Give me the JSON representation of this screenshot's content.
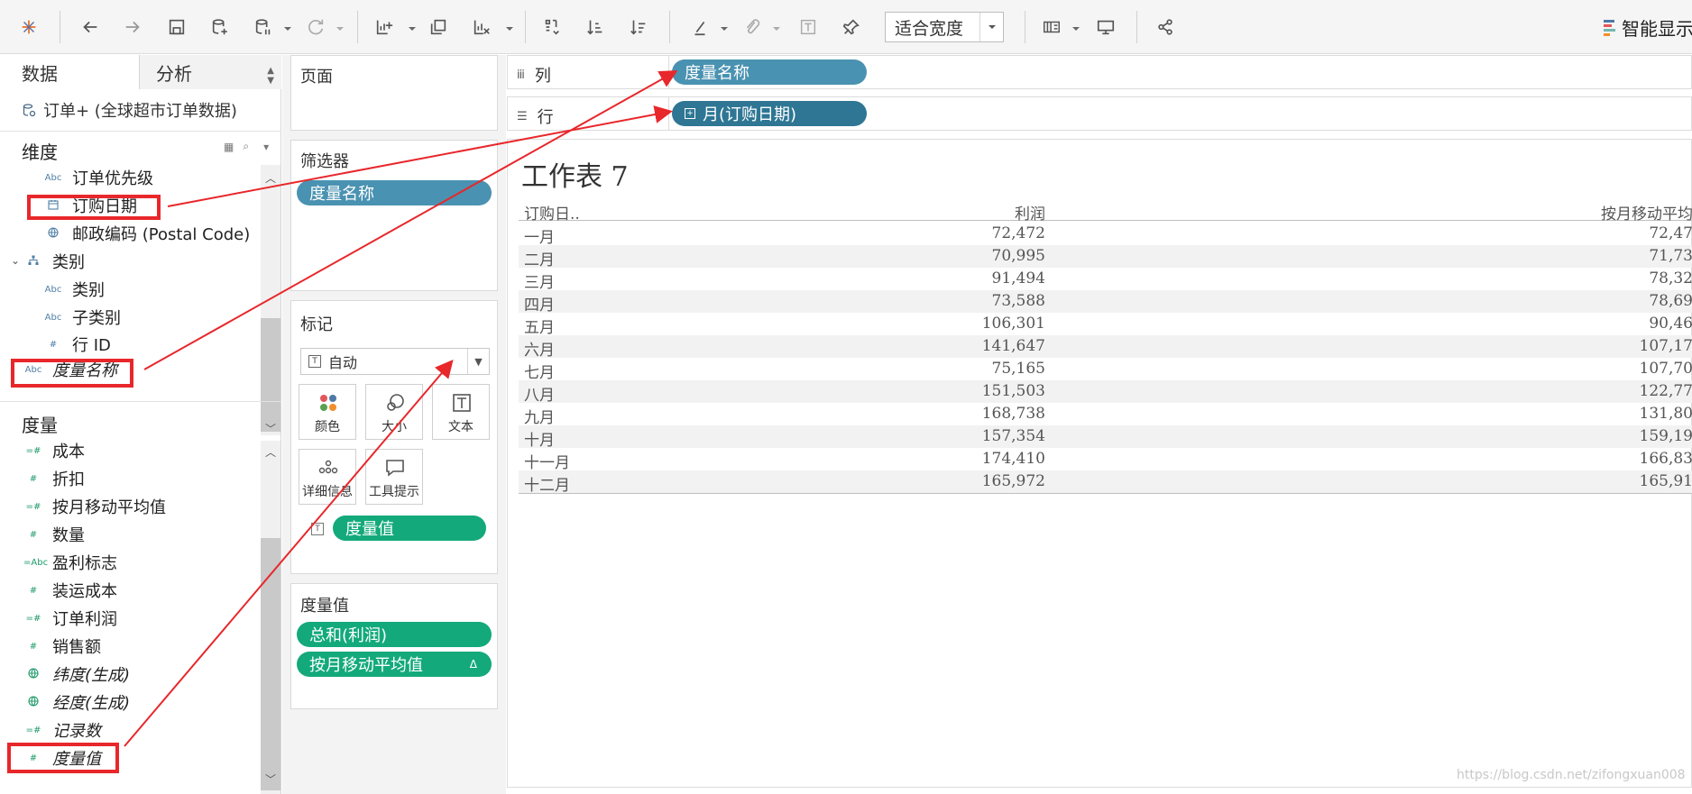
{
  "toolbar": {
    "fit_label": "适合宽度",
    "smart_show_label": "智能显示",
    "accent_colors": [
      "#4e79a7",
      "#e15759",
      "#76b7b2",
      "#f28e2b"
    ]
  },
  "left_pane": {
    "tabs": [
      {
        "label": "数据"
      },
      {
        "label": "分析"
      }
    ],
    "datasource": "订单+ (全球超市订单数据)",
    "dimensions_title": "维度",
    "dimensions": [
      {
        "label": "订单优先级",
        "icon": "Abc"
      },
      {
        "label": "订购日期",
        "icon": "date-icon"
      },
      {
        "label": "邮政编码 (Postal Code)",
        "icon": "globe-icon"
      },
      {
        "label": "类别",
        "icon": "hierarchy-icon"
      },
      {
        "label": "类别",
        "icon": "Abc"
      },
      {
        "label": "子类别",
        "icon": "Abc"
      },
      {
        "label": "行 ID",
        "icon": "#"
      },
      {
        "label": "度量名称",
        "icon": "Abc"
      }
    ],
    "measures_title": "度量",
    "measures": [
      {
        "label": "成本",
        "icon": "=#"
      },
      {
        "label": "折扣",
        "icon": "#"
      },
      {
        "label": "按月移动平均值",
        "icon": "=#"
      },
      {
        "label": "数量",
        "icon": "#"
      },
      {
        "label": "盈利标志",
        "icon": "=Abc"
      },
      {
        "label": "装运成本",
        "icon": "#"
      },
      {
        "label": "订单利润",
        "icon": "=#"
      },
      {
        "label": "销售额",
        "icon": "#"
      },
      {
        "label": "纬度(生成)",
        "icon": "globe-icon"
      },
      {
        "label": "经度(生成)",
        "icon": "globe-icon"
      },
      {
        "label": "记录数",
        "icon": "=#"
      },
      {
        "label": "度量值",
        "icon": "#"
      }
    ]
  },
  "cards": {
    "pages_title": "页面",
    "filters_title": "筛选器",
    "filter_pill": "度量名称",
    "marks_title": "标记",
    "mark_type": "自动",
    "mark_buttons": [
      {
        "label": "颜色"
      },
      {
        "label": "大小"
      },
      {
        "label": "文本"
      },
      {
        "label": "详细信息"
      },
      {
        "label": "工具提示"
      }
    ],
    "marks_pill": "度量值",
    "measure_values_title": "度量值",
    "measure_values": [
      "总和(利润)",
      "按月移动平均值"
    ],
    "delta_glyph": "Δ"
  },
  "shelves": {
    "columns_label": "列",
    "columns_pill": "度量名称",
    "rows_label": "行",
    "rows_pill": "月(订购日期)"
  },
  "view": {
    "title": "工作表 7",
    "headers": [
      "订购日..",
      "利润",
      "按月移动平均"
    ],
    "rows": [
      {
        "month": "一月",
        "profit": "72,472",
        "moving": "72,47"
      },
      {
        "month": "二月",
        "profit": "70,995",
        "moving": "71,73"
      },
      {
        "month": "三月",
        "profit": "91,494",
        "moving": "78,32"
      },
      {
        "month": "四月",
        "profit": "73,588",
        "moving": "78,69"
      },
      {
        "month": "五月",
        "profit": "106,301",
        "moving": "90,46"
      },
      {
        "month": "六月",
        "profit": "141,647",
        "moving": "107,17"
      },
      {
        "month": "七月",
        "profit": "75,165",
        "moving": "107,70"
      },
      {
        "month": "八月",
        "profit": "151,503",
        "moving": "122,77"
      },
      {
        "month": "九月",
        "profit": "168,738",
        "moving": "131,80"
      },
      {
        "month": "十月",
        "profit": "157,354",
        "moving": "159,19"
      },
      {
        "month": "十一月",
        "profit": "174,410",
        "moving": "166,83"
      },
      {
        "month": "十二月",
        "profit": "165,972",
        "moving": "165,91"
      }
    ]
  },
  "watermark": "https://blog.csdn.net/zifongxuan008",
  "annotation_color": "#e8272b"
}
